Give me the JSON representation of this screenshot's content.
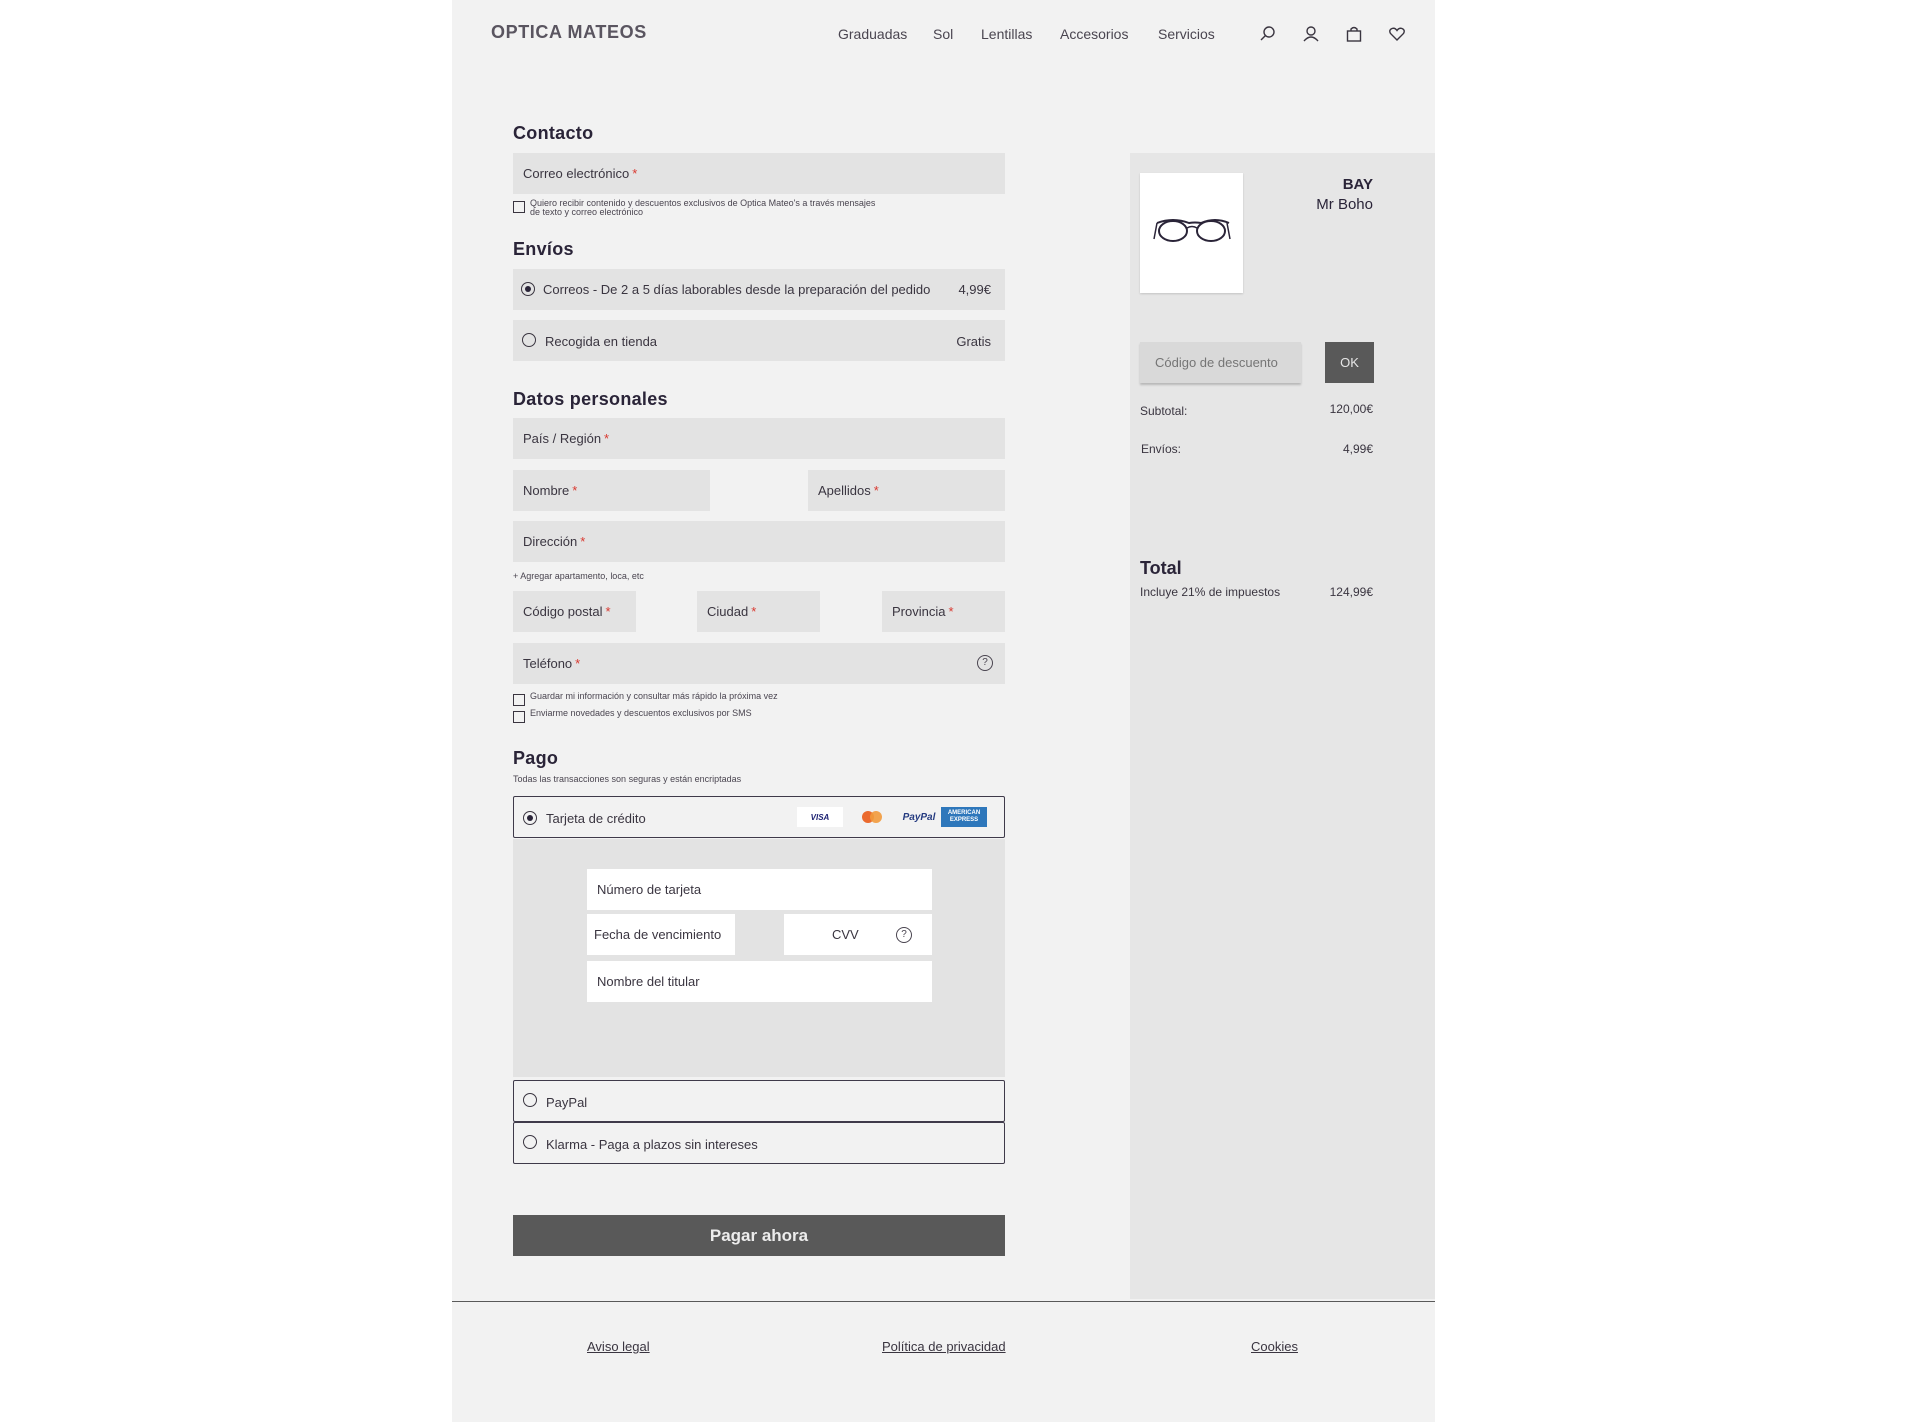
{
  "header": {
    "logo": "OPTICA MATEOS",
    "nav": [
      "Graduadas",
      "Sol",
      "Lentillas",
      "Accesorios",
      "Servicios"
    ],
    "icons": [
      "search-icon",
      "user-icon",
      "bag-icon",
      "heart-icon"
    ]
  },
  "contact": {
    "title": "Contacto",
    "email_label": "Correo electrónico",
    "required_mark": "*",
    "newsletter_line1": "Quiero recibir contenido y descuentos exclusivos de Optica Mateo's a través mensajes",
    "newsletter_line2": "de texto y correo electrónico"
  },
  "shipping": {
    "title": "Envíos",
    "options": [
      {
        "label": "Correos - De 2 a 5 días laborables desde la preparación del pedido",
        "price": "4,99€",
        "selected": true
      },
      {
        "label": "Recogida en tienda",
        "price": "Gratis",
        "selected": false
      }
    ]
  },
  "personal": {
    "title": "Datos personales",
    "country": "País / Región",
    "first_name": "Nombre",
    "last_name": "Apellidos",
    "address": "Dirección",
    "add_apartment": "+ Agregar apartamento, loca, etc",
    "postal_code": "Código postal",
    "city": "Ciudad",
    "province": "Provincia",
    "phone": "Teléfono",
    "save_info": "Guardar mi información y consultar más rápido la próxima vez",
    "sms_news": "Enviarme novedades y descuentos exclusivos por SMS",
    "help_glyph": "?"
  },
  "payment": {
    "title": "Pago",
    "subtitle": "Todas las transacciones son seguras y están encriptadas",
    "card_option": "Tarjeta de crédito",
    "brands": {
      "visa": "VISA",
      "paypal": "PayPal",
      "amex_line1": "AMERICAN",
      "amex_line2": "EXPRESS"
    },
    "card_number": "Número de tarjeta",
    "expiry": "Fecha de vencimiento",
    "cvv": "CVV",
    "holder": "Nombre del titular",
    "paypal_option": "PayPal",
    "klarna_option": "Klarma - Paga a plazos sin intereses",
    "pay_button": "Pagar ahora"
  },
  "summary": {
    "product_brand": "BAY",
    "product_model": "Mr Boho",
    "discount_placeholder": "Código de descuento",
    "ok": "OK",
    "subtotal_label": "Subtotal:",
    "subtotal_value": "120,00€",
    "shipping_label": "Envíos:",
    "shipping_value": "4,99€",
    "total_label": "Total",
    "tax_label": "Incluye 21% de impuestos",
    "total_value": "124,99€"
  },
  "footer": {
    "links": [
      "Aviso legal",
      "Política de privacidad",
      "Cookies"
    ]
  },
  "colors": {
    "page_bg": "#f2f2f2",
    "sidebar_bg": "#e6e6e6",
    "field_bg": "#e3e3e3",
    "button_dark": "#595959",
    "required": "#d9382f",
    "text_dark": "#2a2438",
    "amex_blue": "#2e77bb",
    "mastercard_orange": "#eb6a2e"
  }
}
